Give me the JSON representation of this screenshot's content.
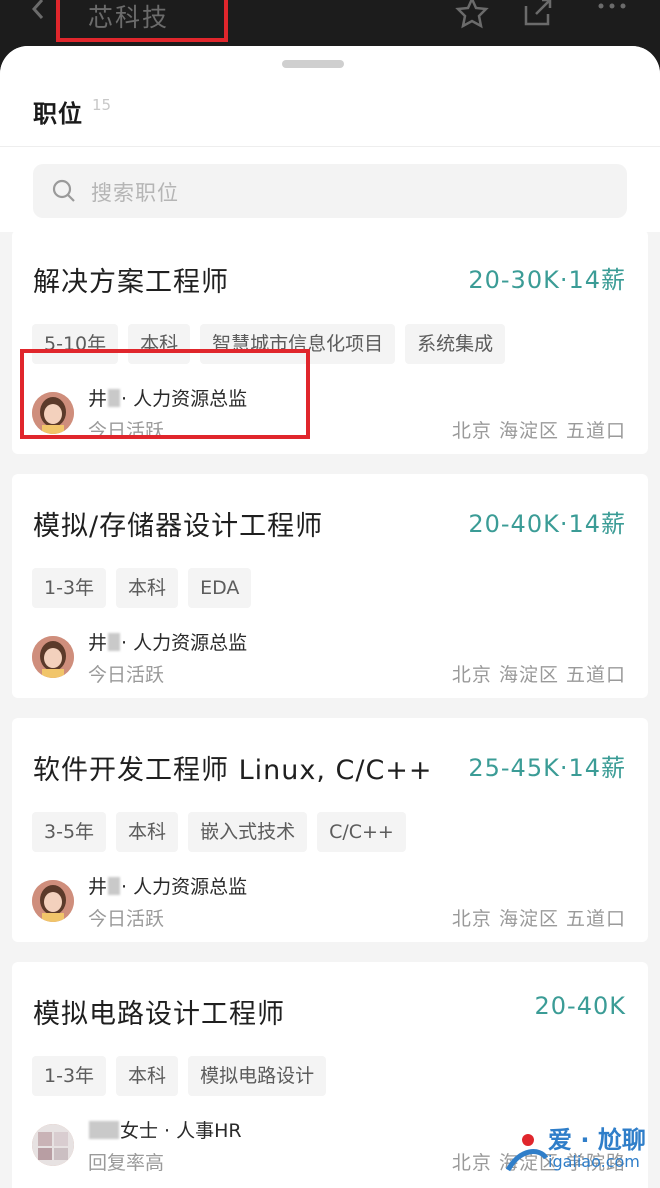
{
  "header": {
    "company_name": "芯科技",
    "icons": [
      "back-icon",
      "star-icon",
      "share-icon",
      "more-icon"
    ]
  },
  "section": {
    "title": "职位",
    "count": "15"
  },
  "search": {
    "placeholder": "搜索职位"
  },
  "jobs": [
    {
      "title": "解决方案工程师",
      "salary": "20-30K·14薪",
      "tags": [
        "5-10年",
        "本科",
        "智慧城市信息化项目",
        "系统集成"
      ],
      "recruiter_prefix": "井",
      "recruiter_suffix": "· 人力资源总监",
      "status": "今日活跃",
      "location": "北京 海淀区 五道口"
    },
    {
      "title": "模拟/存储器设计工程师",
      "salary": "20-40K·14薪",
      "tags": [
        "1-3年",
        "本科",
        "EDA"
      ],
      "recruiter_prefix": "井",
      "recruiter_suffix": "· 人力资源总监",
      "status": "今日活跃",
      "location": "北京 海淀区 五道口"
    },
    {
      "title": "软件开发工程师 Linux, C/C++",
      "salary": "25-45K·14薪",
      "tags": [
        "3-5年",
        "本科",
        "嵌入式技术",
        "C/C++"
      ],
      "recruiter_prefix": "井",
      "recruiter_suffix": "· 人力资源总监",
      "status": "今日活跃",
      "location": "北京 海淀区 五道口"
    },
    {
      "title": "模拟电路设计工程师",
      "salary": "20-40K",
      "tags": [
        "1-3年",
        "本科",
        "模拟电路设计"
      ],
      "recruiter_prefix": "",
      "recruiter_suffix": "女士 · 人事HR",
      "status": "回复率高",
      "location": "北京 海淀区 学院路"
    }
  ],
  "watermark": {
    "text": "爱 · 尬聊",
    "url": "igaliao.com"
  },
  "colors": {
    "salary": "#3b9c96",
    "highlight": "#e0262c"
  }
}
